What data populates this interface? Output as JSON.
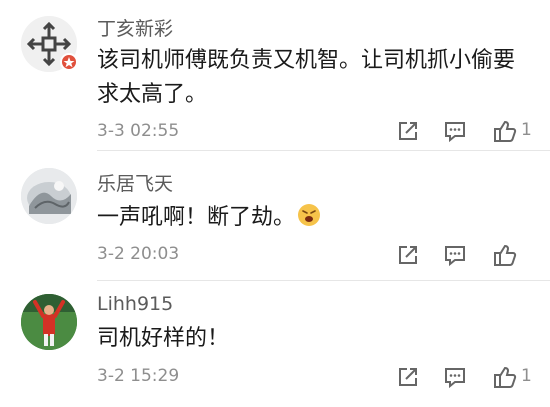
{
  "comments": [
    {
      "username": "丁亥新彩",
      "content": "该司机师傅既负责又机智。让司机抓小偷要求太高了。",
      "time": "3-3 02:55",
      "likes": "1",
      "avatar_icon": "cross-pattern-avatar",
      "verified_badge": true
    },
    {
      "username": "乐居飞天",
      "content": "一声吼啊！断了劫。",
      "emoji": "angry-face-emoji",
      "time": "3-2 20:03",
      "likes": "",
      "avatar_icon": "scenery-avatar"
    },
    {
      "username": "Lihh915",
      "content": "司机好样的！",
      "time": "3-2 15:29",
      "likes": "1",
      "avatar_icon": "soccer-player-avatar"
    }
  ],
  "icons": {
    "share": "share-edit-icon",
    "reply": "comment-icon",
    "like": "thumbs-up-icon"
  },
  "colors": {
    "badge": "#e0503c",
    "text": "#1a1a1a",
    "meta": "#8e8e8e"
  }
}
